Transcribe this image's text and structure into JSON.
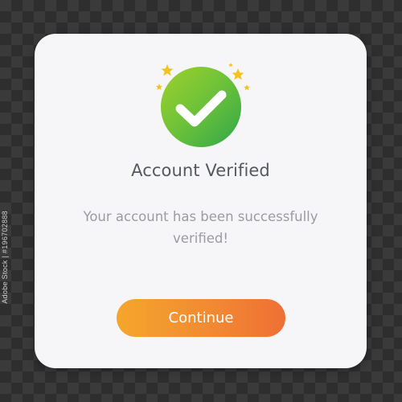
{
  "dialog": {
    "title": "Account Verified",
    "message": "Your account has been successfully verified!",
    "continue_label": "Continue",
    "icon": "checkmark-icon"
  },
  "stock_id": "Adobe Stock | #196702888",
  "colors": {
    "badge_green_start": "#9fd12b",
    "badge_green_end": "#2fa748",
    "button_orange_start": "#f4a62c",
    "button_orange_end": "#ef6f34",
    "sparkle_yellow": "#f2c41d",
    "card_background": "#f6f6f8"
  }
}
